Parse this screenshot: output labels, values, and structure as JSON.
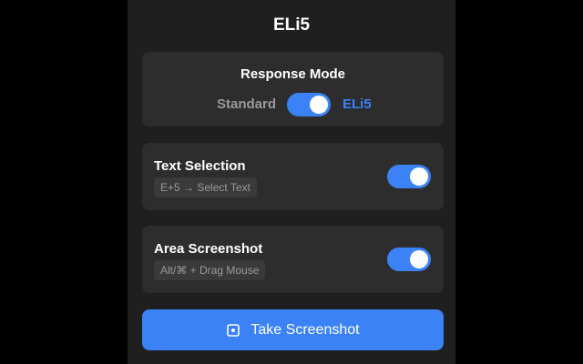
{
  "app": {
    "title": "ELi5"
  },
  "response_mode": {
    "title": "Response Mode",
    "left_option": "Standard",
    "right_option": "ELi5",
    "selected": "ELi5",
    "accent_color": "#3b82f6"
  },
  "settings": [
    {
      "label": "Text Selection",
      "shortcut": "E+5 → Select Text",
      "enabled": true
    },
    {
      "label": "Area Screenshot",
      "shortcut": "Alt/⌘ + Drag Mouse",
      "enabled": true
    }
  ],
  "action": {
    "label": "Take Screenshot",
    "icon": "screenshot-icon"
  },
  "colors": {
    "background": "#1f1f1f",
    "card": "#2d2d2d",
    "accent": "#3b82f6",
    "muted_text": "#9a9a9a"
  }
}
